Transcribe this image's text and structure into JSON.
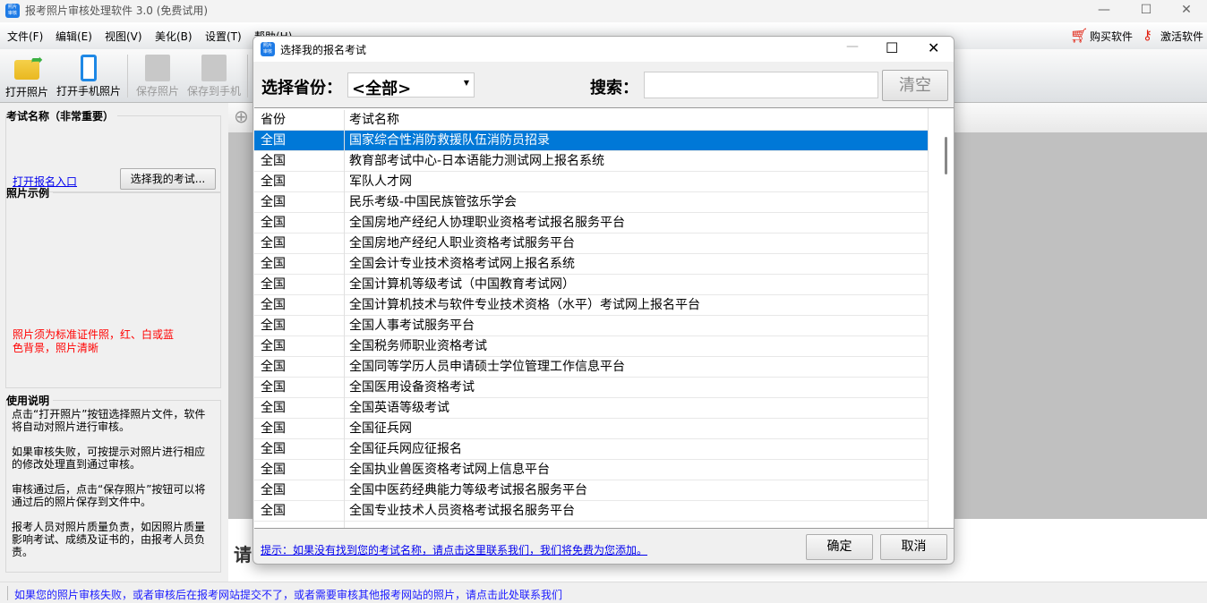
{
  "app": {
    "title": "报考照片审核处理软件 3.0 (免费试用)",
    "icon_text": "照片审核"
  },
  "menu": [
    "文件(F)",
    "编辑(E)",
    "视图(V)",
    "美化(B)",
    "设置(T)",
    "帮助(H)"
  ],
  "menu_right": {
    "buy": "购买软件",
    "activate": "激活软件"
  },
  "toolbar": [
    {
      "label": "打开照片",
      "icon": "open-folder-icon"
    },
    {
      "label": "打开手机照片",
      "icon": "phone-icon"
    },
    {
      "label": "保存照片",
      "icon": "save-icon"
    },
    {
      "label": "保存到手机",
      "icon": "save-to-phone-icon"
    }
  ],
  "left": {
    "exam_group": "考试名称（非常重要）",
    "open_link": "打开报名入口",
    "choose_btn": "选择我的考试...",
    "sample_group": "照片示例",
    "sample_note": "照片须为标准证件照，红、白或蓝色背景，照片清晰",
    "usage_group": "使用说明",
    "usage": [
      "点击“打开照片”按钮选择照片文件，软件将自动对照片进行审核。",
      "如果审核失败，可按提示对照片进行相应的修改处理直到通过审核。",
      "审核通过后，点击“保存照片”按钮可以将通过后的照片保存到文件中。",
      "报考人员对照片质量负责，如因照片质量影响考试、成绩及证书的，由报考人员负责。"
    ]
  },
  "main": {
    "prompt_char": "请"
  },
  "status": "如果您的照片审核失败，或者审核后在报考网站提交不了，或者需要审核其他报考网站的照片，请点击此处联系我们",
  "dialog": {
    "title": "选择我的报名考试",
    "province_label": "选择省份：",
    "province_value": "<全部>",
    "search_label": "搜索：",
    "search_value": "",
    "clear_btn": "清空",
    "columns": [
      "省份",
      "考试名称"
    ],
    "rows": [
      [
        "全国",
        "国家综合性消防救援队伍消防员招录"
      ],
      [
        "全国",
        "教育部考试中心-日本语能力测试网上报名系统"
      ],
      [
        "全国",
        "军队人才网"
      ],
      [
        "全国",
        "民乐考级-中国民族管弦乐学会"
      ],
      [
        "全国",
        "全国房地产经纪人协理职业资格考试报名服务平台"
      ],
      [
        "全国",
        "全国房地产经纪人职业资格考试服务平台"
      ],
      [
        "全国",
        "全国会计专业技术资格考试网上报名系统"
      ],
      [
        "全国",
        "全国计算机等级考试（中国教育考试网）"
      ],
      [
        "全国",
        "全国计算机技术与软件专业技术资格（水平）考试网上报名平台"
      ],
      [
        "全国",
        "全国人事考试服务平台"
      ],
      [
        "全国",
        "全国税务师职业资格考试"
      ],
      [
        "全国",
        "全国同等学历人员申请硕士学位管理工作信息平台"
      ],
      [
        "全国",
        "全国医用设备资格考试"
      ],
      [
        "全国",
        "全国英语等级考试"
      ],
      [
        "全国",
        "全国征兵网"
      ],
      [
        "全国",
        "全国征兵网应征报名"
      ],
      [
        "全国",
        "全国执业兽医资格考试网上信息平台"
      ],
      [
        "全国",
        "全国中医药经典能力等级考试报名服务平台"
      ],
      [
        "全国",
        "全国专业技术人员资格考试报名服务平台"
      ]
    ],
    "selected_index": 0,
    "hint": "提示：如果没有找到您的考试名称，请点击这里联系我们，我们将免费为您添加。",
    "ok": "确定",
    "cancel": "取消"
  },
  "colors": {
    "selection": "#0078d7",
    "link": "#0000ee",
    "warning": "#ff0000"
  }
}
